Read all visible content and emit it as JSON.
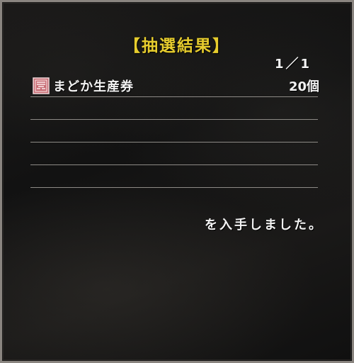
{
  "dialog": {
    "title": "【抽選結果】",
    "page_indicator": "1／1",
    "message": "を入手しました。"
  },
  "results": [
    {
      "icon": "ticket-icon",
      "name": "まどか生産券",
      "quantity": "20個"
    },
    {
      "icon": "",
      "name": "",
      "quantity": ""
    },
    {
      "icon": "",
      "name": "",
      "quantity": ""
    },
    {
      "icon": "",
      "name": "",
      "quantity": ""
    },
    {
      "icon": "",
      "name": "",
      "quantity": ""
    }
  ],
  "colors": {
    "title": "#e6cc2e",
    "text": "#f2f2f2",
    "divider": "#8d8a86",
    "icon": "#c86e76"
  }
}
